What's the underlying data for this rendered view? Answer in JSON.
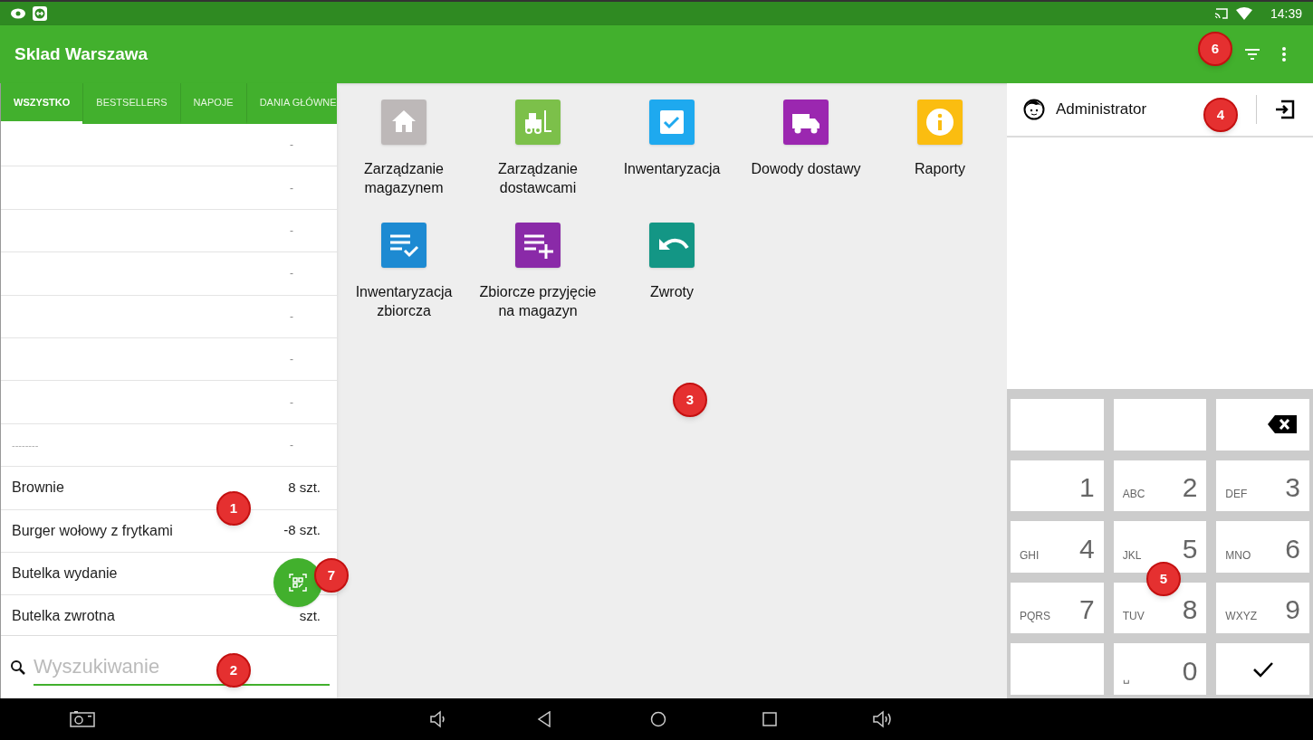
{
  "status_bar": {
    "time": "14:39"
  },
  "app_bar": {
    "title": "Sklad Warszawa"
  },
  "tabs": [
    {
      "label": "WSZYSTKO",
      "selected": true
    },
    {
      "label": "BESTSELLERS",
      "selected": false
    },
    {
      "label": "NAPOJE",
      "selected": false
    },
    {
      "label": "DANIA GŁÓWNE",
      "selected": false
    }
  ],
  "products": [
    {
      "quantity": "-"
    },
    {
      "quantity": "-"
    },
    {
      "quantity": "-"
    },
    {
      "quantity": "-"
    },
    {
      "quantity": "-"
    },
    {
      "quantity": "-"
    },
    {
      "quantity": "-"
    },
    {
      "name": "--------",
      "kind": "placeholder",
      "quantity": "-"
    },
    {
      "name": "Brownie",
      "kind": "item",
      "quantity": "8 szt."
    },
    {
      "name": "Burger wołowy z frytkami",
      "kind": "item",
      "quantity": "-8 szt."
    },
    {
      "name": "Butelka wydanie",
      "kind": "item"
    },
    {
      "name": "Butelka zwrotna",
      "kind": "item",
      "quantity": "szt."
    }
  ],
  "search": {
    "placeholder": "Wyszukiwanie"
  },
  "modules": [
    {
      "label": "Zarządzanie magazynem",
      "kind": "home",
      "color": "#bdb8b8"
    },
    {
      "label": "Zarządzanie dostawcami",
      "kind": "forklift",
      "color": "#7cc04a"
    },
    {
      "label": "Inwentaryzacja",
      "kind": "check",
      "color": "#1ea9ef"
    },
    {
      "label": "Dowody dostawy",
      "kind": "truck",
      "color": "#9b27b0"
    },
    {
      "label": "Raporty",
      "kind": "info",
      "color": "#fbbd10"
    },
    {
      "label": "Inwentaryzacja zbiorcza",
      "kind": "listcheck",
      "color": "#1d8ad2"
    },
    {
      "label": "Zbiorcze przyjęcie na magazyn",
      "kind": "listadd",
      "color": "#8a2aa8"
    },
    {
      "label": "Zwroty",
      "kind": "undo",
      "color": "#139685"
    }
  ],
  "user": {
    "name": "Administrator"
  },
  "keypad": [
    {
      "kind": "blank"
    },
    {
      "kind": "blank"
    },
    {
      "kind": "backspace"
    },
    {
      "kind": "digit",
      "digit": "1"
    },
    {
      "kind": "digit",
      "digit": "2",
      "letters": "ABC"
    },
    {
      "kind": "digit",
      "digit": "3",
      "letters": "DEF"
    },
    {
      "kind": "digit",
      "digit": "4",
      "letters": "GHI"
    },
    {
      "kind": "digit",
      "digit": "5",
      "letters": "JKL"
    },
    {
      "kind": "digit",
      "digit": "6",
      "letters": "MNO"
    },
    {
      "kind": "digit",
      "digit": "7",
      "letters": "PQRS"
    },
    {
      "kind": "digit",
      "digit": "8",
      "letters": "TUV"
    },
    {
      "kind": "digit",
      "digit": "9",
      "letters": "WXYZ"
    },
    {
      "kind": "blank"
    },
    {
      "kind": "digit",
      "digit": "0",
      "letters": "␣"
    },
    {
      "kind": "confirm"
    }
  ],
  "callouts": [
    "1",
    "2",
    "3",
    "4",
    "5",
    "6",
    "7"
  ]
}
